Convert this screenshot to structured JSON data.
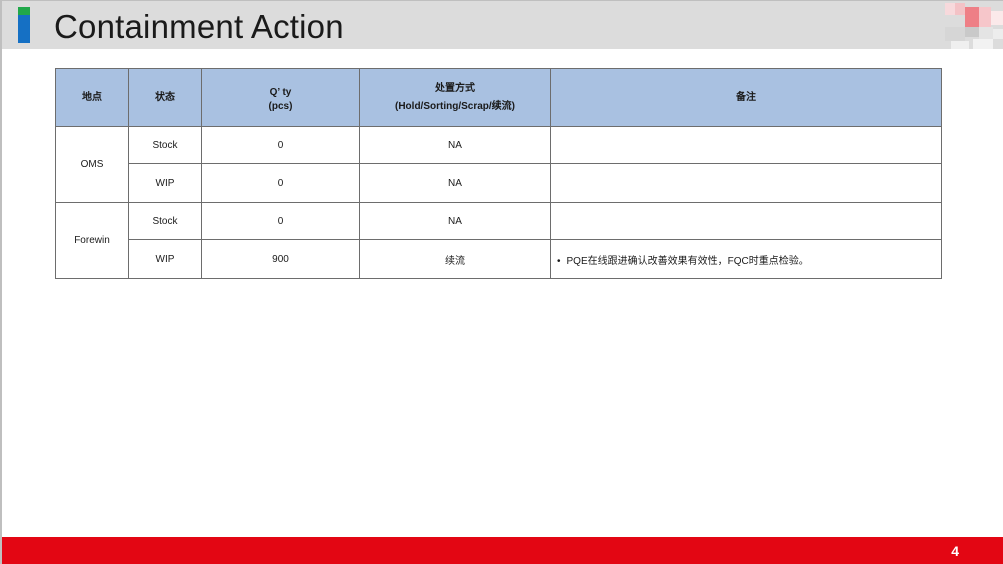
{
  "slide": {
    "title": "Containment Action",
    "page_number": "4",
    "colors": {
      "title_bar": "#dcdcdc",
      "accent_green": "#21a84a",
      "accent_blue": "#1570c4",
      "table_header": "#a9c1e1",
      "footer": "#e30613"
    }
  },
  "table": {
    "headers": {
      "location": "地点",
      "status": "状态",
      "qty_line1": "Q’ ty",
      "qty_line2": "(pcs)",
      "method_line1": "处置方式",
      "method_line2": "(Hold/Sorting/Scrap/续流)",
      "remarks": "备注"
    },
    "groups": [
      {
        "location": "OMS",
        "rows": [
          {
            "status": "Stock",
            "qty": "0",
            "method": "NA",
            "remark": ""
          },
          {
            "status": "WIP",
            "qty": "0",
            "method": "NA",
            "remark": ""
          }
        ]
      },
      {
        "location": "Forewin",
        "rows": [
          {
            "status": "Stock",
            "qty": "0",
            "method": "NA",
            "remark": ""
          },
          {
            "status": "WIP",
            "qty": "900",
            "method": "续流",
            "remark": "PQE在线跟进确认改善效果有效性，FQC时重点检验。"
          }
        ]
      }
    ]
  }
}
